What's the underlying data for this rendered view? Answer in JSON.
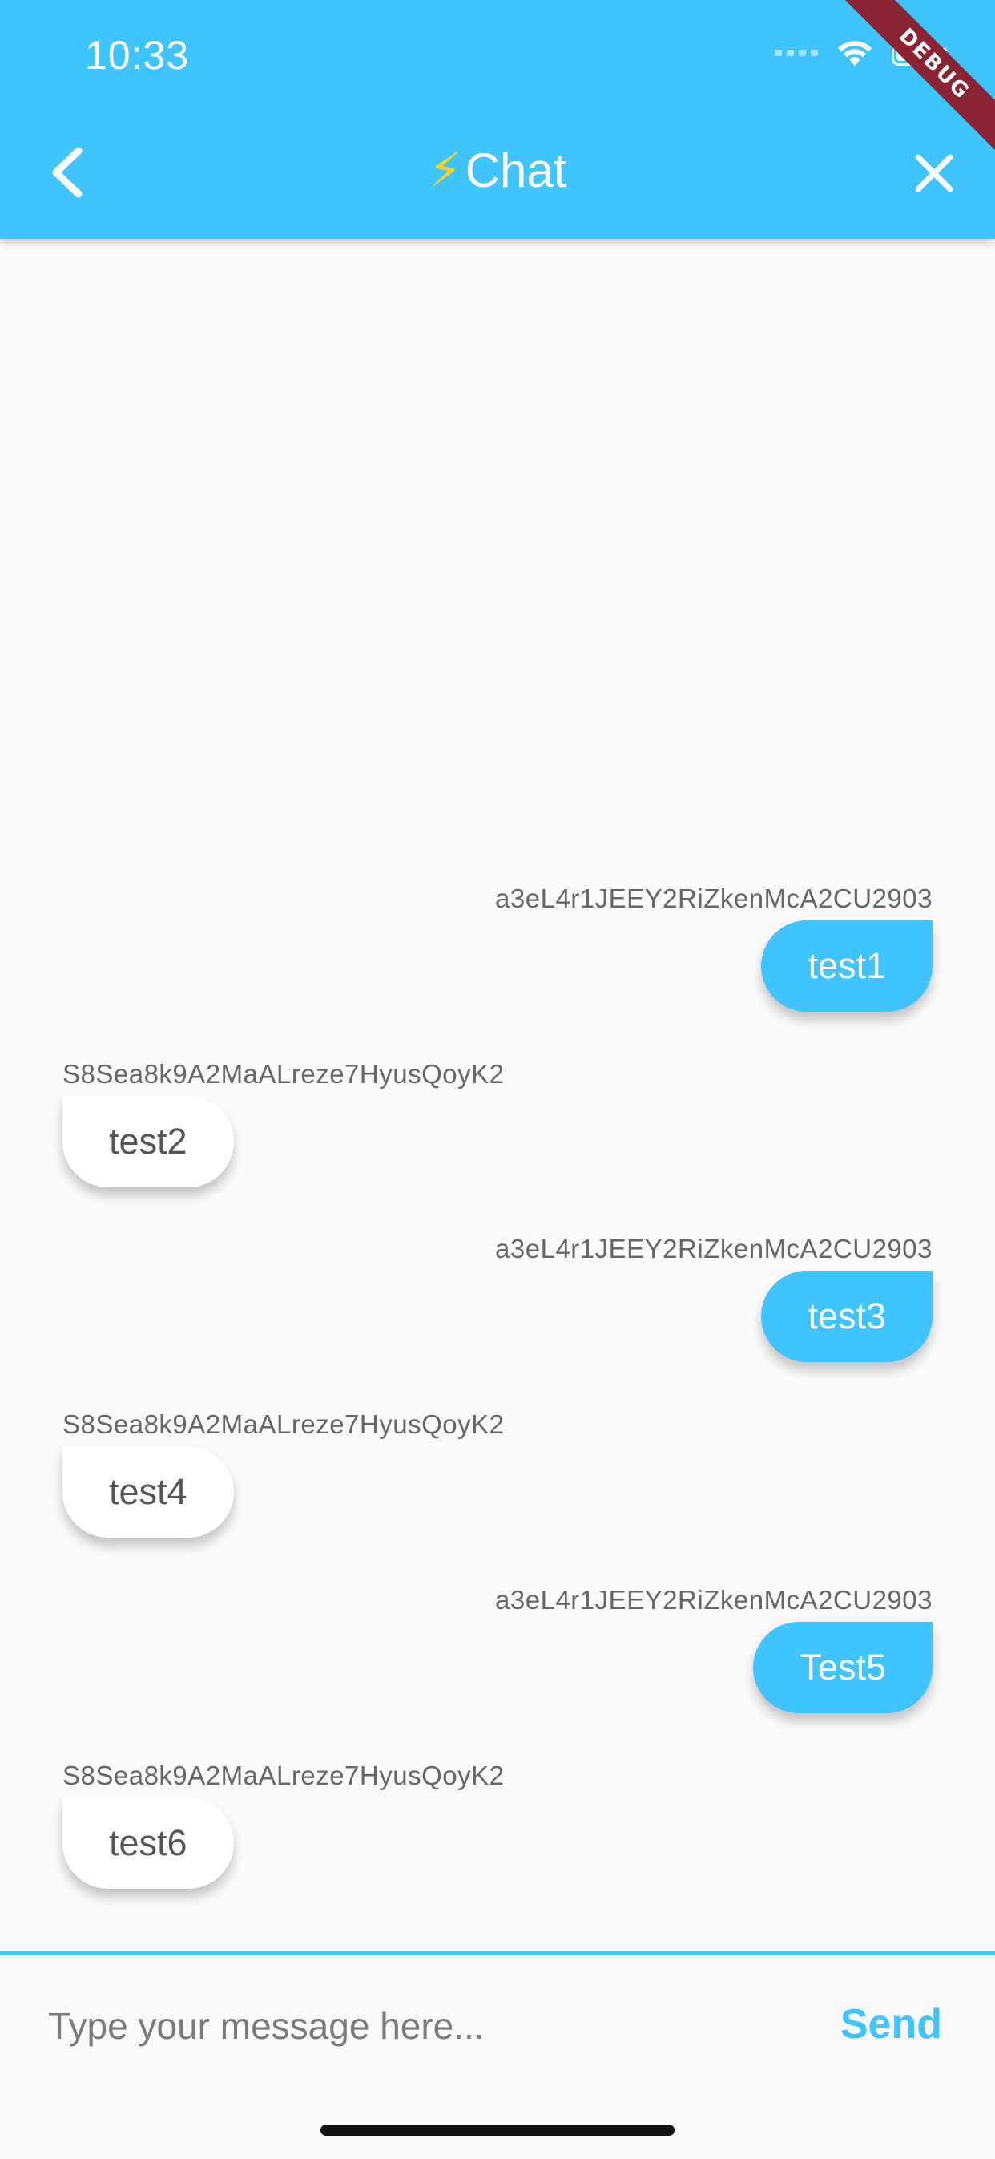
{
  "status_bar": {
    "time": "10:33"
  },
  "debug_banner": "DEBUG",
  "header": {
    "bolt": "⚡",
    "title": "Chat"
  },
  "messages": [
    {
      "author": "a3eL4r1JEEY2RiZkenMcA2CU2903",
      "text": "test1",
      "mine": true
    },
    {
      "author": "S8Sea8k9A2MaALreze7HyusQoyK2",
      "text": "test2",
      "mine": false
    },
    {
      "author": "a3eL4r1JEEY2RiZkenMcA2CU2903",
      "text": "test3",
      "mine": true
    },
    {
      "author": "S8Sea8k9A2MaALreze7HyusQoyK2",
      "text": "test4",
      "mine": false
    },
    {
      "author": "a3eL4r1JEEY2RiZkenMcA2CU2903",
      "text": "Test5",
      "mine": true
    },
    {
      "author": "S8Sea8k9A2MaALreze7HyusQoyK2",
      "text": "test6",
      "mine": false
    }
  ],
  "composer": {
    "placeholder": "Type your message here...",
    "value": "",
    "send_label": "Send"
  },
  "colors": {
    "accent": "#40c4ff",
    "background": "#fafafa",
    "debug": "#8a2433"
  },
  "icons": {
    "back": "chevron-left-icon",
    "close": "close-icon",
    "wifi": "wifi-icon",
    "battery": "battery-icon"
  }
}
